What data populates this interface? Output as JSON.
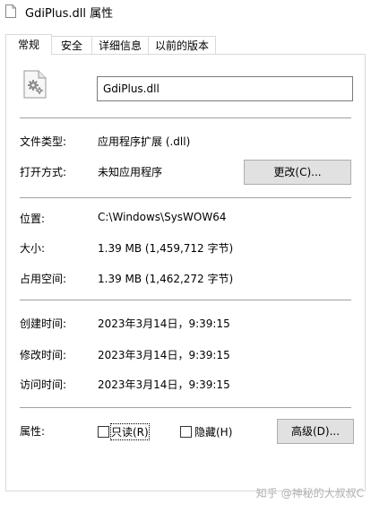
{
  "window": {
    "title": "GdiPlus.dll 属性"
  },
  "tabs": [
    {
      "label": "常规",
      "active": true
    },
    {
      "label": "安全",
      "active": false
    },
    {
      "label": "详细信息",
      "active": false
    },
    {
      "label": "以前的版本",
      "active": false
    }
  ],
  "general": {
    "icon": "dll-file-gear-icon",
    "file_name": "GdiPlus.dll",
    "file_type_label": "文件类型:",
    "file_type_value": "应用程序扩展 (.dll)",
    "opens_with_label": "打开方式:",
    "opens_with_value": "未知应用程序",
    "change_button": "更改(C)...",
    "location_label": "位置:",
    "location_value": "C:\\Windows\\SysWOW64",
    "size_label": "大小:",
    "size_value": "1.39 MB (1,459,712 字节)",
    "size_on_disk_label": "占用空间:",
    "size_on_disk_value": "1.39 MB (1,462,272 字节)",
    "created_label": "创建时间:",
    "created_value": "2023年3月14日，9:39:15",
    "modified_label": "修改时间:",
    "modified_value": "2023年3月14日，9:39:15",
    "accessed_label": "访问时间:",
    "accessed_value": "2023年3月14日，9:39:15",
    "attributes_label": "属性:",
    "readonly_label": "只读(R)",
    "readonly_checked": false,
    "hidden_label": "隐藏(H)",
    "hidden_checked": false,
    "advanced_button": "高级(D)..."
  },
  "watermark": "知乎 @神秘的大叔叔C"
}
